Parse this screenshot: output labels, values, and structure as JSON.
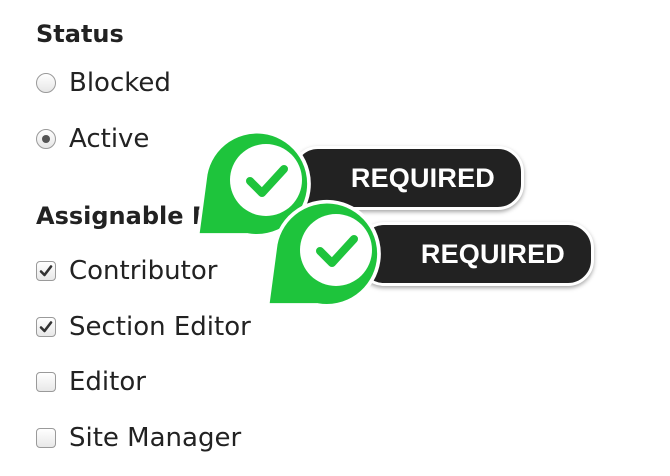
{
  "status": {
    "heading": "Status",
    "options": [
      {
        "label": "Blocked",
        "selected": false
      },
      {
        "label": "Active",
        "selected": true
      }
    ]
  },
  "roles": {
    "heading": "Assignable Roles",
    "options": [
      {
        "label": "Contributor",
        "checked": true
      },
      {
        "label": "Section Editor",
        "checked": true
      },
      {
        "label": "Editor",
        "checked": false
      },
      {
        "label": "Site Manager",
        "checked": false
      }
    ]
  },
  "badges": [
    {
      "label": "REQUIRED",
      "icon": "check-icon",
      "color": "#1ec43c"
    },
    {
      "label": "REQUIRED",
      "icon": "check-icon",
      "color": "#1ec43c"
    }
  ]
}
